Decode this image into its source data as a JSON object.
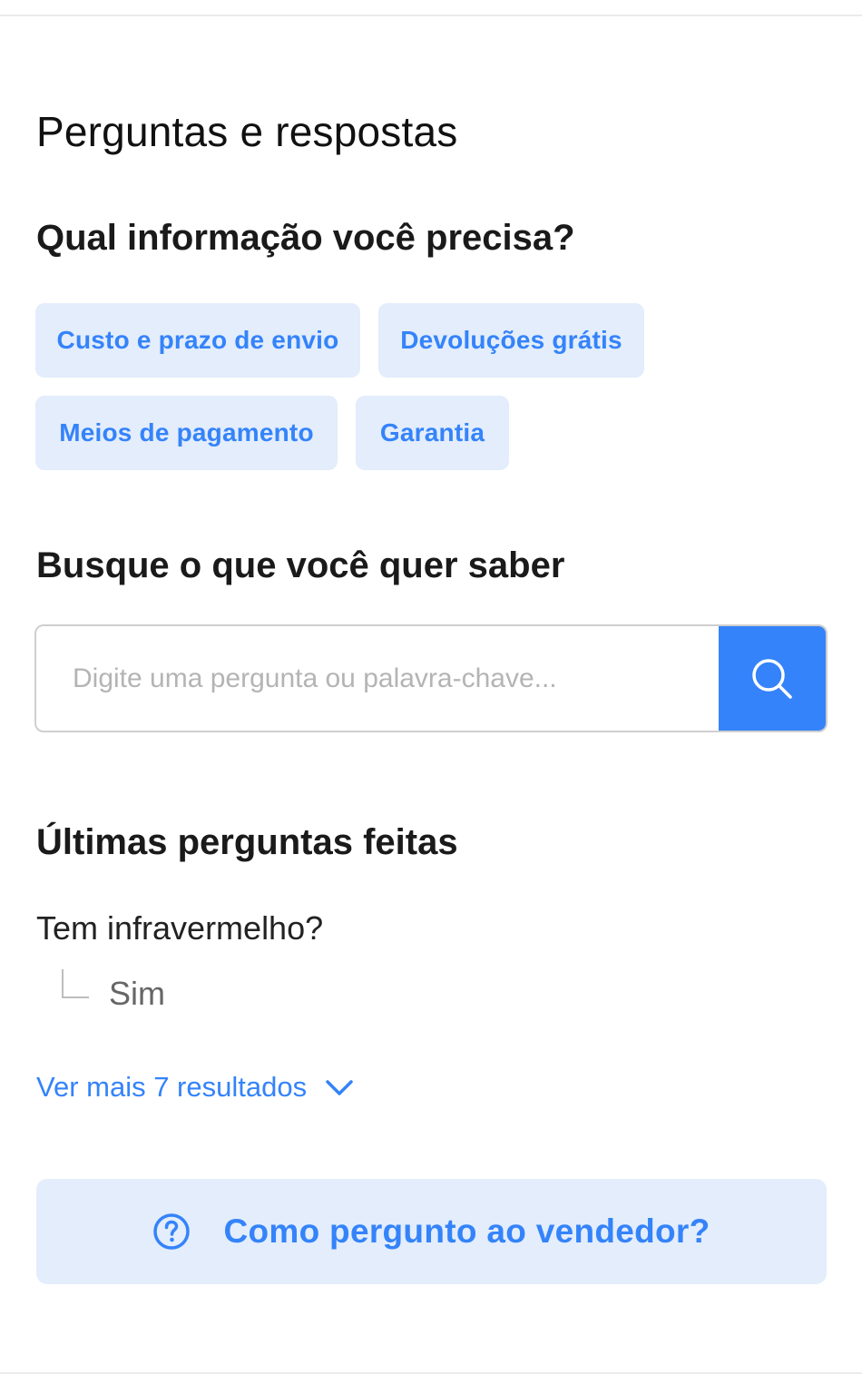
{
  "qa": {
    "title": "Perguntas e respostas",
    "info_question": "Qual informação você precisa?",
    "chips": [
      {
        "label": "Custo e prazo de envio"
      },
      {
        "label": "Devoluções grátis"
      },
      {
        "label": "Meios de pagamento"
      },
      {
        "label": "Garantia"
      }
    ],
    "search_heading": "Busque o que você quer saber",
    "search": {
      "placeholder": "Digite uma pergunta ou palavra-chave...",
      "value": "",
      "button_icon": "search-icon"
    },
    "latest_heading": "Últimas perguntas feitas",
    "latest": [
      {
        "question": "Tem infravermelho?",
        "answer": "Sim"
      }
    ],
    "see_more": "Ver mais 7 resultados",
    "ask_seller": "Como pergunto ao vendedor?"
  },
  "colors": {
    "accent": "#3483fa",
    "chip_bg": "#e3edfb",
    "text": "#222222"
  }
}
